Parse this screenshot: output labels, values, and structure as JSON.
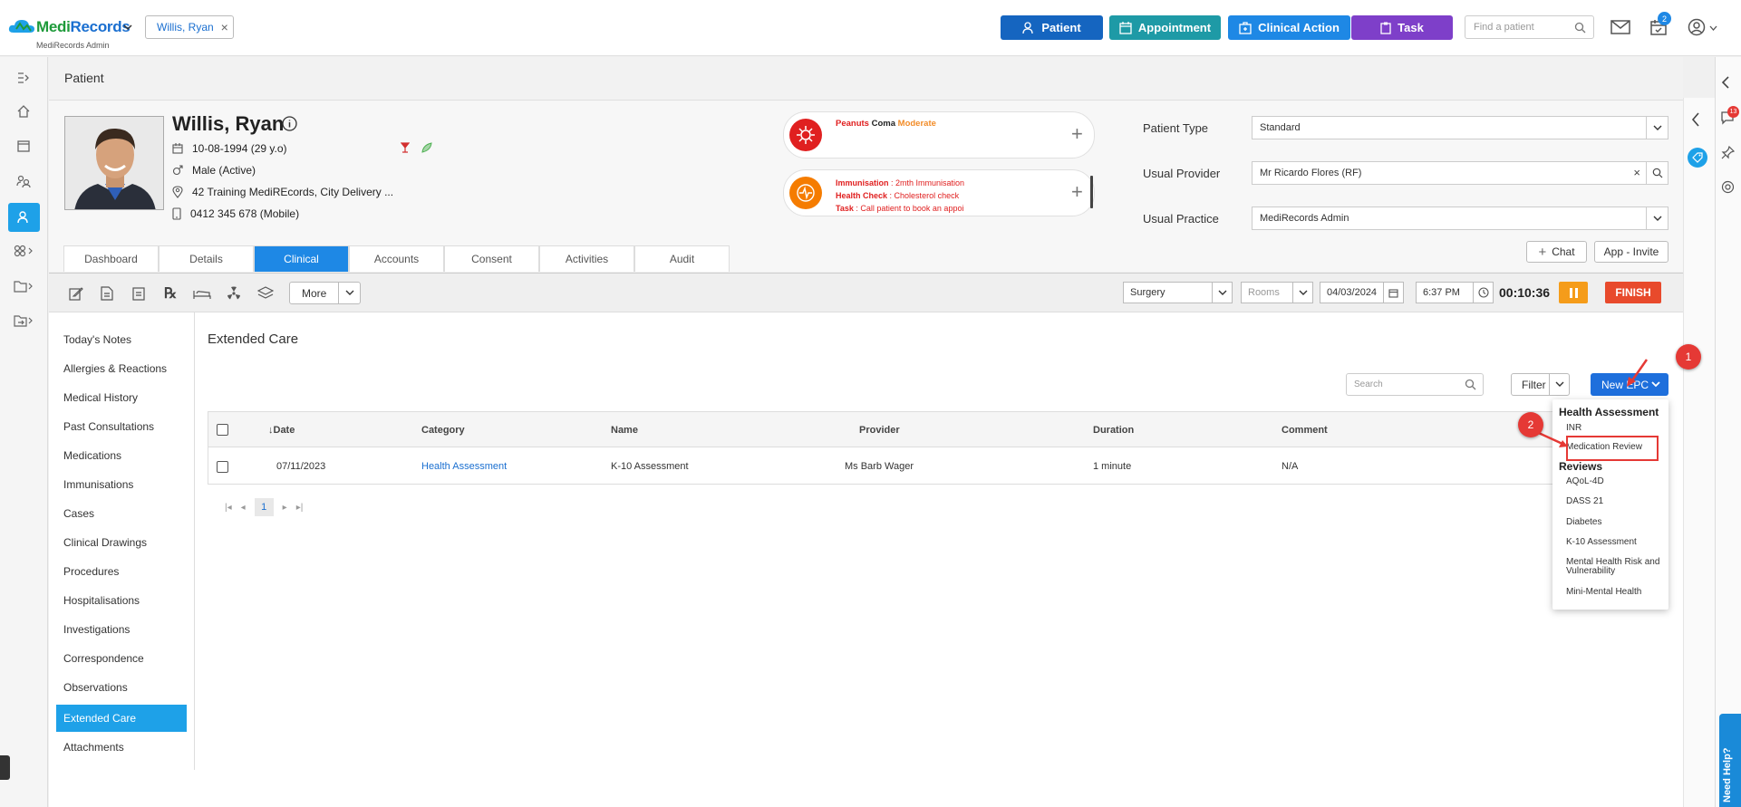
{
  "app": {
    "name_green": "Medi",
    "name_blue": "Records",
    "org": "MediRecords Admin"
  },
  "patient_tab": {
    "label": "Willis, Ryan"
  },
  "header_buttons": [
    {
      "label": "Patient",
      "color": "#1565c0"
    },
    {
      "label": "Appointment",
      "color": "#1e9aa6"
    },
    {
      "label": "Clinical Action",
      "color": "#1e88e5"
    },
    {
      "label": "Task",
      "color": "#7e3fc9"
    }
  ],
  "find_patient": {
    "placeholder": "Find a patient"
  },
  "notifications": {
    "tasks_count": "2",
    "right_badge": "13"
  },
  "page": {
    "title": "Patient"
  },
  "patient": {
    "name": "Willis, Ryan",
    "dob": "10-08-1994 (29 y.o)",
    "gender": "Male (Active)",
    "address": "42 Training MediREcords, City Delivery ...",
    "phone": "0412 345 678 (Mobile)"
  },
  "alerts": {
    "allergy_item": "Peanuts",
    "allergy_reaction": "Coma",
    "allergy_severity": "Moderate",
    "reminders": [
      {
        "label": "Immunisation",
        "value": "2mth Immunisation"
      },
      {
        "label": "Health Check",
        "value": "Cholesterol check"
      },
      {
        "label": "Task",
        "value": "Call patient to book an appoi"
      }
    ]
  },
  "fields": [
    {
      "label": "Patient Type",
      "value": "Standard"
    },
    {
      "label": "Usual Provider",
      "value": "Mr Ricardo Flores (RF)"
    },
    {
      "label": "Usual Practice",
      "value": "MediRecords Admin"
    }
  ],
  "chat_label": "Chat",
  "app_invite_label": "App - Invite",
  "tabs": [
    "Dashboard",
    "Details",
    "Clinical",
    "Accounts",
    "Consent",
    "Activities",
    "Audit"
  ],
  "active_tab": "Clinical",
  "toolbar": {
    "more_label": "More",
    "location": "Surgery",
    "rooms_placeholder": "Rooms",
    "date": "04/03/2024",
    "time": "6:37 PM",
    "timer": "00:10:36",
    "finish_label": "FINISH"
  },
  "sidenav": [
    "Today's Notes",
    "Allergies & Reactions",
    "Medical History",
    "Past Consultations",
    "Medications",
    "Immunisations",
    "Cases",
    "Clinical Drawings",
    "Procedures",
    "Hospitalisations",
    "Investigations",
    "Correspondence",
    "Observations",
    "Extended Care",
    "Attachments"
  ],
  "sidenav_active": "Extended Care",
  "section": {
    "title": "Extended Care",
    "search_placeholder": "Search",
    "filter_label": "Filter",
    "new_epc_label": "New EPC"
  },
  "grid": {
    "headers": [
      "Date",
      "Category",
      "Name",
      "Provider",
      "Duration",
      "Comment"
    ],
    "sort_arrow": "↓",
    "rows": [
      {
        "date": "07/11/2023",
        "category": "Health Assessment",
        "name": "K-10 Assessment",
        "provider": "Ms Barb Wager",
        "duration": "1 minute",
        "comment": "N/A"
      }
    ],
    "page": "1"
  },
  "dropdown": {
    "group1": "Health Assessment",
    "group1_items": [
      "INR",
      "Medication Review"
    ],
    "group2": "Reviews",
    "group2_items": [
      "AQoL-4D",
      "DASS 21",
      "Diabetes",
      "K-10 Assessment",
      "Mental Health Risk and Vulnerability",
      "Mini-Mental Health"
    ]
  },
  "step_badges": [
    "1",
    "2"
  ],
  "help_label": "Need Help?"
}
